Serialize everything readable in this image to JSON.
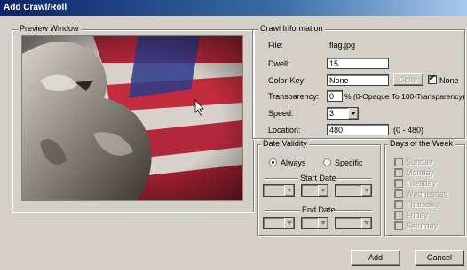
{
  "window": {
    "title": "Add Crawl/Roll"
  },
  "preview": {
    "legend": "Preview Window"
  },
  "crawl": {
    "legend": "Crawl Information",
    "file_label": "File:",
    "file_value": "flag.jpg",
    "dwell_label": "Dwell:",
    "dwell_value": "15",
    "colorkey_label": "Color-Key:",
    "colorkey_value": "None",
    "color_button": "Color",
    "none_label": "None",
    "transparency_label": "Transparency:",
    "transparency_value": "0",
    "transparency_hint": "% (0-Opaque To 100-Transparency)",
    "speed_label": "Speed:",
    "speed_value": "3",
    "location_label": "Location:",
    "location_value": "480",
    "location_hint": "(0 - 480)"
  },
  "validity": {
    "legend": "Date Validity",
    "always": "Always",
    "specific": "Specific",
    "start_date": "Start Date",
    "end_date": "End Date"
  },
  "days": {
    "legend": "Days of the Week",
    "items": [
      "Sunday",
      "Monday",
      "Tuesday",
      "Wednesday",
      "Thursday",
      "Friday",
      "Saturday"
    ]
  },
  "buttons": {
    "add": "Add",
    "cancel": "Cancel"
  }
}
